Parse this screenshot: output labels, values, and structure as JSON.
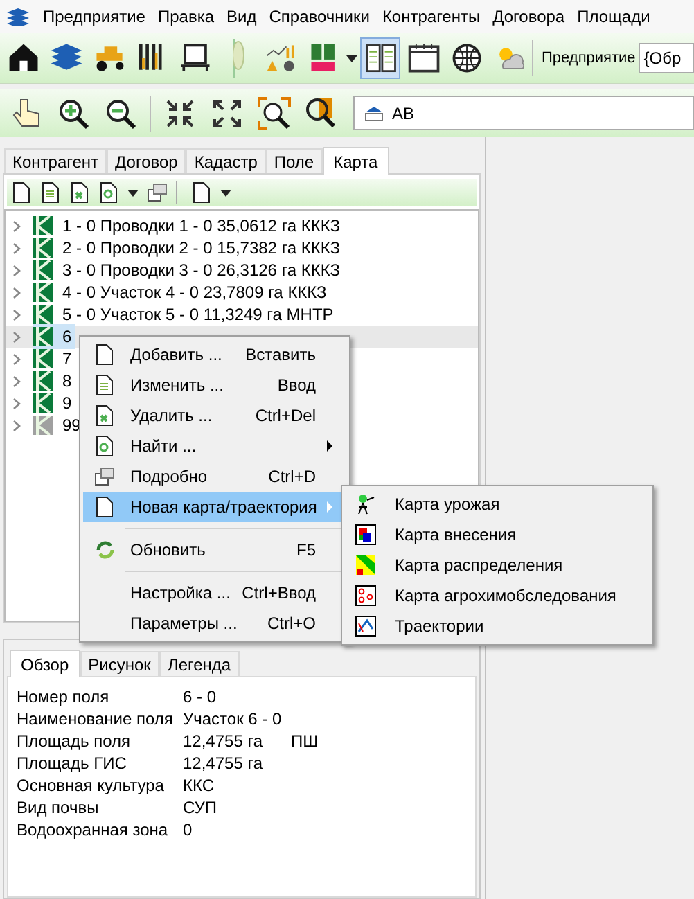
{
  "menu_bar": [
    "Предприятие",
    "Правка",
    "Вид",
    "Справочники",
    "Контрагенты",
    "Договора",
    "Площади"
  ],
  "toolbar": [
    {
      "selected": false
    },
    {
      "selected": false
    },
    {
      "selected": false
    },
    {
      "selected": false
    },
    {
      "selected": false
    },
    {
      "selected": false
    },
    {
      "selected": false
    },
    {
      "selected": false
    },
    {
      "selected": true
    },
    {
      "selected": false
    },
    {
      "selected": false
    },
    {
      "selected": false
    }
  ],
  "enterprise": {
    "label": "Предприятие",
    "value": "{Обр"
  },
  "map_toolbar": {
    "layer_field": "АВ"
  },
  "tabs": [
    {
      "label": "Контрагент",
      "selected": false
    },
    {
      "label": "Договор",
      "selected": false
    },
    {
      "label": "Кадастр",
      "selected": false
    },
    {
      "label": "Поле",
      "selected": false
    },
    {
      "label": "Карта",
      "selected": true
    }
  ],
  "tree": [
    {
      "text": "1 - 0 Проводки 1 - 0 35,0612 га КККЗ",
      "selected": false,
      "inactive": false
    },
    {
      "text": "2 - 0 Проводки 2 - 0 15,7382 га КККЗ",
      "selected": false,
      "inactive": false
    },
    {
      "text": "3 - 0 Проводки 3 - 0 26,3126 га КККЗ",
      "selected": false,
      "inactive": false
    },
    {
      "text": "4 - 0 Участок 4 - 0 23,7809 га КККЗ",
      "selected": false,
      "inactive": false
    },
    {
      "text": "5 - 0 Участок 5 - 0 11,3249 га МНТР",
      "selected": false,
      "inactive": false
    },
    {
      "text": "6",
      "selected": true,
      "inactive": false
    },
    {
      "text": "7",
      "selected": false,
      "inactive": false
    },
    {
      "text": "8",
      "selected": false,
      "inactive": false
    },
    {
      "text": "9",
      "selected": false,
      "inactive": false
    },
    {
      "text": "99",
      "selected": false,
      "inactive": true
    }
  ],
  "context_menu": [
    {
      "kind": "item",
      "label": "Добавить ...",
      "shortcut": "Вставить",
      "submenu": false,
      "selected": false
    },
    {
      "kind": "item",
      "label": "Изменить ...",
      "shortcut": "Ввод",
      "submenu": false,
      "selected": false
    },
    {
      "kind": "item",
      "label": "Удалить ...",
      "shortcut": "Ctrl+Del",
      "submenu": false,
      "selected": false
    },
    {
      "kind": "item",
      "label": "Найти ...",
      "submenu": true,
      "selected": false
    },
    {
      "kind": "item",
      "label": "Подробно",
      "shortcut": "Ctrl+D",
      "submenu": false,
      "selected": false
    },
    {
      "kind": "item",
      "label": "Новая карта/траектория",
      "submenu": true,
      "selected": true
    },
    {
      "kind": "separator"
    },
    {
      "kind": "item",
      "label": "Обновить",
      "shortcut": "F5",
      "submenu": false,
      "selected": false
    },
    {
      "kind": "separator"
    },
    {
      "kind": "item",
      "label": "Настройка ...",
      "shortcut": "Ctrl+Ввод",
      "submenu": false,
      "selected": false
    },
    {
      "kind": "item",
      "label": "Параметры ...",
      "shortcut": "Ctrl+O",
      "submenu": false,
      "selected": false
    }
  ],
  "submenu": [
    "Карта урожая",
    "Карта внесения",
    "Карта распределения",
    "Карта агрохимобследования",
    "Траектории"
  ],
  "detail_tabs": [
    {
      "label": "Обзор",
      "selected": true
    },
    {
      "label": "Рисунок",
      "selected": false
    },
    {
      "label": "Легенда",
      "selected": false
    }
  ],
  "properties": [
    {
      "label": "Номер поля",
      "value": "6 - 0"
    },
    {
      "label": "Наименование поля",
      "value": "Участок 6 - 0"
    },
    {
      "label": "Площадь поля",
      "value": "12,4755 га",
      "extra": "ПШ"
    },
    {
      "label": "Площадь ГИС",
      "value": "12,4755 га"
    },
    {
      "label": "Основная культура",
      "value": "ККС"
    },
    {
      "label": "Вид почвы",
      "value": "СУП"
    },
    {
      "label": "Водоохранная зона",
      "value": "0"
    }
  ]
}
